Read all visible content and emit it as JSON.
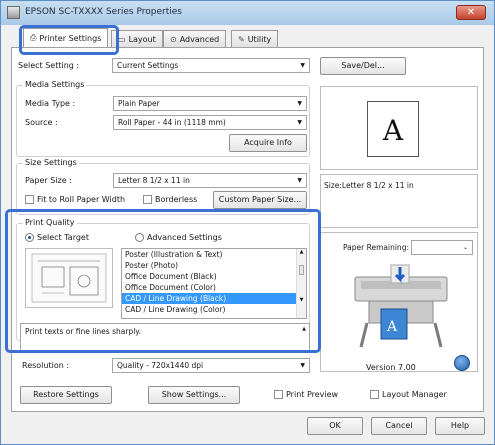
{
  "window": {
    "title": "EPSON SC-TXXXX Series Properties",
    "close_glyph": "✕"
  },
  "tabs": [
    {
      "label": "Printer Settings",
      "icon": "printer-icon"
    },
    {
      "label": "Layout",
      "icon": "layout-icon"
    },
    {
      "label": "Advanced",
      "icon": "advanced-icon"
    },
    {
      "label": "Utility",
      "icon": "utility-icon"
    }
  ],
  "select_setting": {
    "label": "Select Setting :",
    "value": "Current Settings",
    "save_del": "Save/Del..."
  },
  "media": {
    "title": "Media Settings",
    "type_label": "Media Type :",
    "type_value": "Plain Paper",
    "source_label": "Source :",
    "source_value": "Roll Paper - 44 in (1118 mm)",
    "acquire": "Acquire Info"
  },
  "size": {
    "title": "Size Settings",
    "paper_label": "Paper Size :",
    "paper_value": "Letter 8 1/2 x 11 in",
    "fit_roll": "Fit to Roll Paper Width",
    "borderless": "Borderless",
    "custom": "Custom Paper Size..."
  },
  "preview": {
    "letter": "A",
    "size_text": "Size:Letter 8 1/2 x 11 in"
  },
  "quality": {
    "title": "Print Quality",
    "select_target": "Select Target",
    "advanced_settings": "Advanced Settings",
    "targets": [
      "Poster (Illustration & Text)",
      "Poster (Photo)",
      "Office Document (Black)",
      "Office Document (Color)",
      "CAD / Line Drawing (Black)",
      "CAD / Line Drawing (Color)"
    ],
    "selected_index": 4,
    "description": "Print texts or fine lines sharply."
  },
  "paper_remaining": {
    "label": "Paper Remaining:"
  },
  "resolution": {
    "label": "Resolution :",
    "value": "Quality - 720x1440 dpi"
  },
  "version": "Version 7.00",
  "buttons": {
    "restore": "Restore Settings",
    "show": "Show Settings...",
    "print_preview": "Print Preview",
    "layout_manager": "Layout Manager",
    "ok": "OK",
    "cancel": "Cancel",
    "help": "Help"
  },
  "colors": {
    "highlight": "#3b6fd4",
    "selection": "#3399ff"
  }
}
